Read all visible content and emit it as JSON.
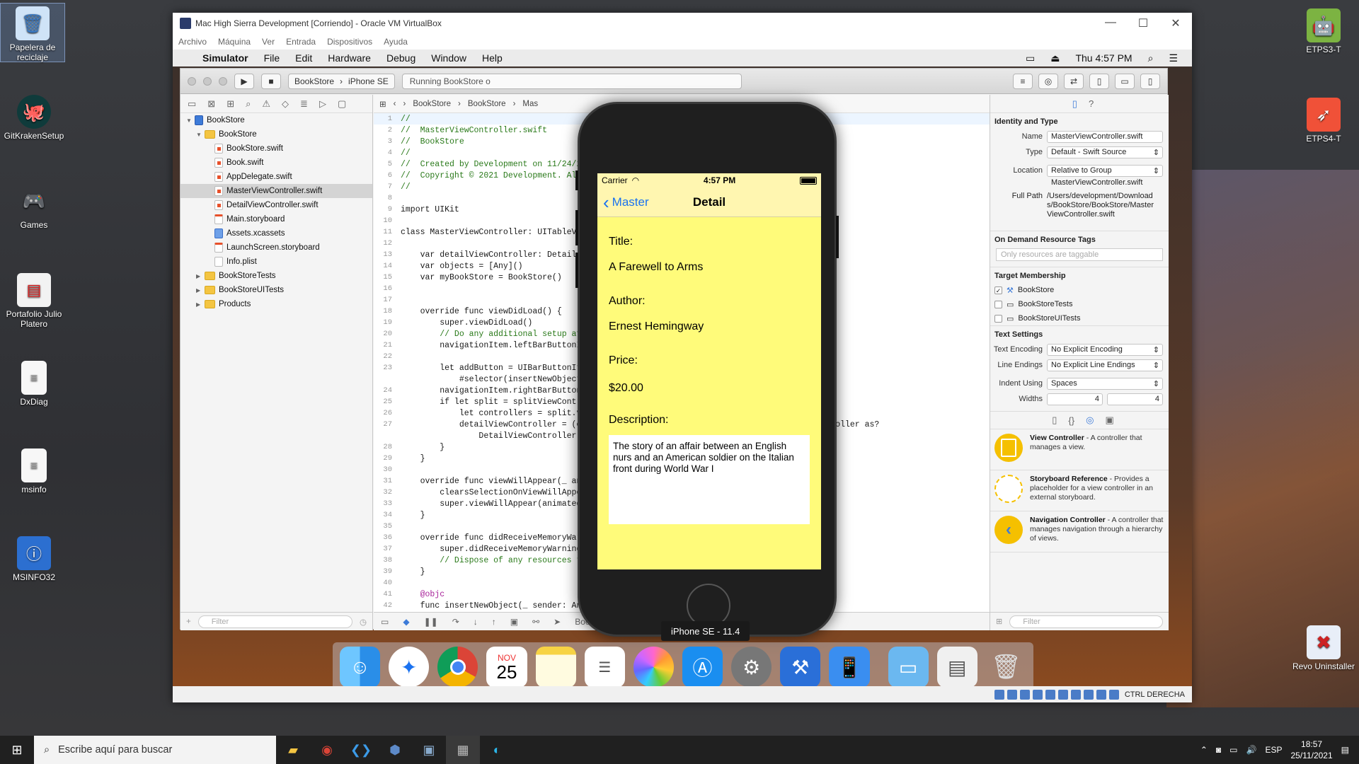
{
  "desktop_icons": [
    {
      "label": "Papelera de reciclaje",
      "icon": "recycle-bin-icon"
    },
    {
      "label": "GitKrakenSetup",
      "icon": "gitkraken-icon"
    },
    {
      "label": "Games",
      "icon": "gamepad-icon"
    },
    {
      "label": "Portafolio Julio Platero",
      "icon": "pdf-icon"
    },
    {
      "label": "DxDiag",
      "icon": "document-icon"
    },
    {
      "label": "msinfo",
      "icon": "document-icon"
    },
    {
      "label": "MSINFO32",
      "icon": "monitor-info-icon"
    },
    {
      "label": "ETPS3-T",
      "icon": "android-icon"
    },
    {
      "label": "ETPS4-T",
      "icon": "swift-icon"
    },
    {
      "label": "Revo Uninstaller",
      "icon": "uninstaller-icon"
    }
  ],
  "vm": {
    "title": "Mac High Sierra Development [Corriendo] - Oracle VM VirtualBox",
    "menu": [
      "Archivo",
      "Máquina",
      "Ver",
      "Entrada",
      "Dispositivos",
      "Ayuda"
    ],
    "status_text": "CTRL DERECHA"
  },
  "mac_menu": {
    "app": "Simulator",
    "items": [
      "File",
      "Edit",
      "Hardware",
      "Debug",
      "Window",
      "Help"
    ],
    "clock": "Thu 4:57 PM"
  },
  "xcode": {
    "scheme": "BookStore",
    "device": "iPhone SE",
    "status": "Running BookStore o",
    "jump": [
      "BookStore",
      "BookStore",
      "Mas"
    ],
    "tree": [
      {
        "label": "BookStore",
        "type": "proj",
        "depth": 0,
        "disc": "▼"
      },
      {
        "label": "BookStore",
        "type": "folder",
        "depth": 1,
        "disc": "▼"
      },
      {
        "label": "BookStore.swift",
        "type": "swift",
        "depth": 2
      },
      {
        "label": "Book.swift",
        "type": "swift",
        "depth": 2
      },
      {
        "label": "AppDelegate.swift",
        "type": "swift",
        "depth": 2
      },
      {
        "label": "MasterViewController.swift",
        "type": "swift",
        "depth": 2,
        "sel": true
      },
      {
        "label": "DetailViewController.swift",
        "type": "swift",
        "depth": 2
      },
      {
        "label": "Main.storyboard",
        "type": "sb",
        "depth": 2
      },
      {
        "label": "Assets.xcassets",
        "type": "xc",
        "depth": 2
      },
      {
        "label": "LaunchScreen.storyboard",
        "type": "sb",
        "depth": 2
      },
      {
        "label": "Info.plist",
        "type": "pl",
        "depth": 2
      },
      {
        "label": "BookStoreTests",
        "type": "folder",
        "depth": 1,
        "disc": "▶"
      },
      {
        "label": "BookStoreUITests",
        "type": "folder",
        "depth": 1,
        "disc": "▶"
      },
      {
        "label": "Products",
        "type": "folder",
        "depth": 1,
        "disc": "▶"
      }
    ],
    "filter_placeholder": "Filter",
    "editor_footer": "BookStore",
    "code": [
      {
        "n": "1",
        "t": "//",
        "c": "c"
      },
      {
        "n": "2",
        "t": "//  MasterViewController.swift",
        "c": "c"
      },
      {
        "n": "3",
        "t": "//  BookStore",
        "c": "c"
      },
      {
        "n": "4",
        "t": "//",
        "c": "c"
      },
      {
        "n": "5",
        "t": "//  Created by Development on 11/24/2",
        "c": "c"
      },
      {
        "n": "6",
        "t": "//  Copyright © 2021 Development. All",
        "c": "c"
      },
      {
        "n": "7",
        "t": "//",
        "c": "c"
      },
      {
        "n": "8",
        "t": "",
        "c": ""
      },
      {
        "n": "9",
        "t": "import UIKit",
        "c": ""
      },
      {
        "n": "10",
        "t": "",
        "c": ""
      },
      {
        "n": "11",
        "t": "class MasterViewController: UITableVi",
        "c": ""
      },
      {
        "n": "12",
        "t": "",
        "c": ""
      },
      {
        "n": "13",
        "t": "    var detailViewController: Detail",
        "c": ""
      },
      {
        "n": "14",
        "t": "    var objects = [Any]()",
        "c": ""
      },
      {
        "n": "15",
        "t": "    var myBookStore = BookStore()",
        "c": ""
      },
      {
        "n": "16",
        "t": "",
        "c": ""
      },
      {
        "n": "17",
        "t": "",
        "c": ""
      },
      {
        "n": "18",
        "t": "    override func viewDidLoad() {",
        "c": ""
      },
      {
        "n": "19",
        "t": "        super.viewDidLoad()",
        "c": ""
      },
      {
        "n": "20",
        "t": "        // Do any additional setup af",
        "c": "c"
      },
      {
        "n": "21",
        "t": "        navigationItem.leftBarButtonI",
        "c": ""
      },
      {
        "n": "22",
        "t": "",
        "c": ""
      },
      {
        "n": "23",
        "t": "        let addButton = UIBarButtonIt",
        "c": ""
      },
      {
        "n": "",
        "t": "            #selector(insertNewObject",
        "c": ""
      },
      {
        "n": "24",
        "t": "        navigationItem.rightBarButton",
        "c": ""
      },
      {
        "n": "25",
        "t": "        if let split = splitViewContr",
        "c": ""
      },
      {
        "n": "26",
        "t": "            let controllers = split.v",
        "c": ""
      },
      {
        "n": "27",
        "t": "            detailViewController = (c                                  ller).topViewController as?",
        "c": ""
      },
      {
        "n": "",
        "t": "                DetailViewController",
        "c": ""
      },
      {
        "n": "28",
        "t": "        }",
        "c": ""
      },
      {
        "n": "29",
        "t": "    }",
        "c": ""
      },
      {
        "n": "30",
        "t": "",
        "c": ""
      },
      {
        "n": "31",
        "t": "    override func viewWillAppear(_ an",
        "c": ""
      },
      {
        "n": "32",
        "t": "        clearsSelectionOnViewWillAppe",
        "c": ""
      },
      {
        "n": "33",
        "t": "        super.viewWillAppear(animated",
        "c": ""
      },
      {
        "n": "34",
        "t": "    }",
        "c": ""
      },
      {
        "n": "35",
        "t": "",
        "c": ""
      },
      {
        "n": "36",
        "t": "    override func didReceiveMemoryWar",
        "c": ""
      },
      {
        "n": "37",
        "t": "        super.didReceiveMemoryWarning",
        "c": ""
      },
      {
        "n": "38",
        "t": "        // Dispose of any resources t",
        "c": "c"
      },
      {
        "n": "39",
        "t": "    }",
        "c": ""
      },
      {
        "n": "40",
        "t": "",
        "c": ""
      },
      {
        "n": "41",
        "t": "    @objc",
        "c": "k"
      },
      {
        "n": "42",
        "t": "    func insertNewObject(_ sender: Any) {",
        "c": ""
      }
    ],
    "inspector": {
      "identity_header": "Identity and Type",
      "name_label": "Name",
      "name": "MasterViewController.swift",
      "type_label": "Type",
      "type": "Default - Swift Source",
      "location_label": "Location",
      "location": "Relative to Group",
      "location_file": "MasterViewController.swift",
      "fullpath_label": "Full Path",
      "fullpath": "/Users/development/Downloads/BookStore/BookStore/MasterViewController.swift",
      "odr_header": "On Demand Resource Tags",
      "odr_placeholder": "Only resources are taggable",
      "target_header": "Target Membership",
      "targets": [
        {
          "label": "BookStore",
          "checked": "✓"
        },
        {
          "label": "BookStoreTests",
          "checked": ""
        },
        {
          "label": "BookStoreUITests",
          "checked": ""
        }
      ],
      "text_header": "Text Settings",
      "encoding_label": "Text Encoding",
      "encoding": "No Explicit Encoding",
      "endings_label": "Line Endings",
      "endings": "No Explicit Line Endings",
      "indent_label": "Indent Using",
      "indent": "Spaces",
      "widths_label": "Widths",
      "width1": "4",
      "width2": "4",
      "library": [
        {
          "title": "View Controller",
          "desc": " - A controller that manages a view."
        },
        {
          "title": "Storyboard Reference",
          "desc": " - Provides a placeholder for a view controller in an external storyboard."
        },
        {
          "title": "Navigation Controller",
          "desc": " - A controller that manages navigation through a hierarchy of views."
        }
      ],
      "filter_placeholder": "Filter"
    }
  },
  "simulator": {
    "label": "iPhone SE - 11.4",
    "carrier": "Carrier",
    "time": "4:57 PM",
    "back": "Master",
    "title": "Detail",
    "title_label": "Title:",
    "title_value": "A Farewell to Arms",
    "author_label": "Author:",
    "author_value": "Ernest Hemingway",
    "price_label": "Price:",
    "price_value": "$20.00",
    "desc_label": "Description:",
    "desc_value": "The story of an affair between an English nurs and an American soldier on the Italian front during World War I"
  },
  "dock": [
    "finder-icon",
    "safari-icon",
    "chrome-icon",
    "calendar-icon",
    "notes-icon",
    "reminders-icon",
    "photos-icon",
    "app-store-icon",
    "system-preferences-icon",
    "xcode-icon",
    "simulator-icon",
    "folder-icon",
    "preview-icon",
    "trash-icon"
  ],
  "calendar": {
    "month": "NOV",
    "day": "25"
  },
  "taskbar": {
    "search_placeholder": "Escribe aquí para buscar",
    "lang": "ESP",
    "time": "18:57",
    "date": "25/11/2021"
  },
  "colors": {
    "screen_bg": "#fffb7a",
    "ios_blue": "#1a72f0",
    "selection": "#d4d4d4"
  }
}
